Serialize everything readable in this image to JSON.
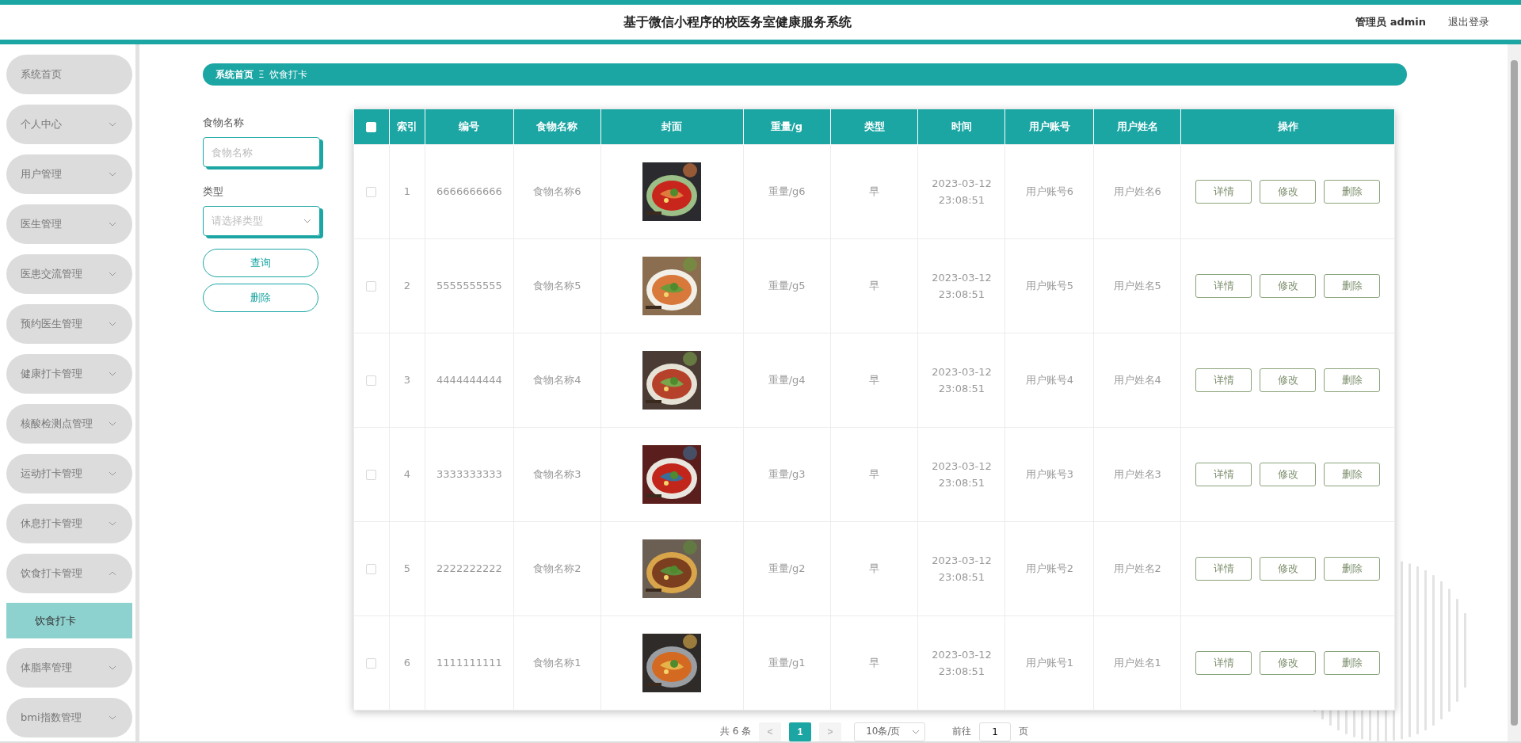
{
  "header": {
    "title": "基于微信小程序的校医务室健康服务系统",
    "user": "管理员 admin",
    "logout": "退出登录"
  },
  "sidebar": {
    "items": [
      {
        "label": "系统首页",
        "kind": "link"
      },
      {
        "label": "个人中心",
        "kind": "menu",
        "expanded": false
      },
      {
        "label": "用户管理",
        "kind": "menu",
        "expanded": false
      },
      {
        "label": "医生管理",
        "kind": "menu",
        "expanded": false
      },
      {
        "label": "医患交流管理",
        "kind": "menu",
        "expanded": false
      },
      {
        "label": "预约医生管理",
        "kind": "menu",
        "expanded": false
      },
      {
        "label": "健康打卡管理",
        "kind": "menu",
        "expanded": false
      },
      {
        "label": "核酸检测点管理",
        "kind": "menu",
        "expanded": false
      },
      {
        "label": "运动打卡管理",
        "kind": "menu",
        "expanded": false
      },
      {
        "label": "休息打卡管理",
        "kind": "menu",
        "expanded": false
      },
      {
        "label": "饮食打卡管理",
        "kind": "menu",
        "expanded": true,
        "children": [
          {
            "label": "饮食打卡",
            "selected": true
          }
        ]
      },
      {
        "label": "体脂率管理",
        "kind": "menu",
        "expanded": false
      },
      {
        "label": "bmi指数管理",
        "kind": "menu",
        "expanded": false
      }
    ]
  },
  "breadcrumb": {
    "items": [
      "系统首页",
      "饮食打卡"
    ],
    "separator": "Ξ"
  },
  "search": {
    "fields": [
      {
        "label": "食物名称",
        "kind": "text",
        "placeholder": "食物名称"
      },
      {
        "label": "类型",
        "kind": "select",
        "placeholder": "请选择类型"
      }
    ],
    "buttons": [
      "查询",
      "删除"
    ]
  },
  "table": {
    "header_checked": false,
    "columns": [
      "索引",
      "编号",
      "食物名称",
      "封面",
      "重量/g",
      "类型",
      "时间",
      "用户账号",
      "用户姓名",
      "操作"
    ],
    "rows": [
      {
        "checked": false,
        "index": "1",
        "code": "6666666666",
        "name": "食物名称6",
        "weight": "重量/g6",
        "type": "早",
        "time": "2023-03-12 23:08:51",
        "account": "用户账号6",
        "username": "用户姓名6",
        "actions": [
          "详情",
          "修改",
          "删除"
        ]
      },
      {
        "checked": false,
        "index": "2",
        "code": "5555555555",
        "name": "食物名称5",
        "weight": "重量/g5",
        "type": "早",
        "time": "2023-03-12 23:08:51",
        "account": "用户账号5",
        "username": "用户姓名5",
        "actions": [
          "详情",
          "修改",
          "删除"
        ]
      },
      {
        "checked": false,
        "index": "3",
        "code": "4444444444",
        "name": "食物名称4",
        "weight": "重量/g4",
        "type": "早",
        "time": "2023-03-12 23:08:51",
        "account": "用户账号4",
        "username": "用户姓名4",
        "actions": [
          "详情",
          "修改",
          "删除"
        ]
      },
      {
        "checked": false,
        "index": "4",
        "code": "3333333333",
        "name": "食物名称3",
        "weight": "重量/g3",
        "type": "早",
        "time": "2023-03-12 23:08:51",
        "account": "用户账号3",
        "username": "用户姓名3",
        "actions": [
          "详情",
          "修改",
          "删除"
        ]
      },
      {
        "checked": false,
        "index": "5",
        "code": "2222222222",
        "name": "食物名称2",
        "weight": "重量/g2",
        "type": "早",
        "time": "2023-03-12 23:08:51",
        "account": "用户账号2",
        "username": "用户姓名2",
        "actions": [
          "详情",
          "修改",
          "删除"
        ]
      },
      {
        "checked": false,
        "index": "6",
        "code": "1111111111",
        "name": "食物名称1",
        "weight": "重量/g1",
        "type": "早",
        "time": "2023-03-12 23:08:51",
        "account": "用户账号1",
        "username": "用户姓名1",
        "actions": [
          "详情",
          "修改",
          "删除"
        ]
      }
    ]
  },
  "pagination": {
    "total": "共 6 条",
    "prev": "<",
    "pages": [
      {
        "label": "1",
        "selected": true
      }
    ],
    "next": ">",
    "page_size": "10条/页",
    "goto": "前往",
    "goto_value": "1",
    "page_unit": "页"
  }
}
